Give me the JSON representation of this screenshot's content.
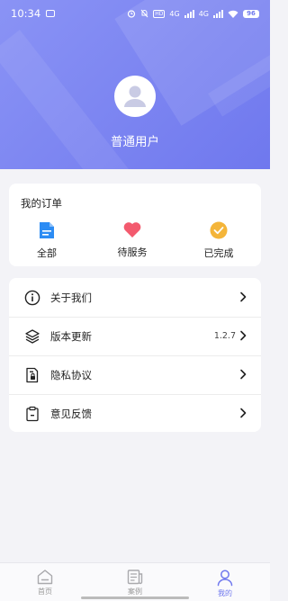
{
  "status_bar": {
    "time": "10:34",
    "net_labels": [
      "4G",
      "4G"
    ],
    "battery": "96"
  },
  "profile": {
    "username": "普通用户"
  },
  "orders": {
    "title": "我的订单",
    "items": [
      {
        "label": "全部",
        "icon": "document-icon",
        "color": "#2c8cf4"
      },
      {
        "label": "待服务",
        "icon": "heart-icon",
        "color": "#f35a6e"
      },
      {
        "label": "已完成",
        "icon": "check-circle-icon",
        "color": "#f4b53a"
      }
    ]
  },
  "menu": {
    "items": [
      {
        "label": "关于我们",
        "icon": "info-icon"
      },
      {
        "label": "版本更新",
        "icon": "layers-icon",
        "value": "1.2.7"
      },
      {
        "label": "隐私协议",
        "icon": "file-lock-icon"
      },
      {
        "label": "意见反馈",
        "icon": "clipboard-icon"
      }
    ]
  },
  "tabbar": {
    "items": [
      {
        "label": "首页",
        "icon": "home-icon",
        "active": false
      },
      {
        "label": "案例",
        "icon": "news-icon",
        "active": false
      },
      {
        "label": "我的",
        "icon": "user-icon",
        "active": true
      }
    ]
  },
  "colors": {
    "header": "#7b83f2",
    "accent": "#6f78ee",
    "background": "#f3f3f7"
  }
}
